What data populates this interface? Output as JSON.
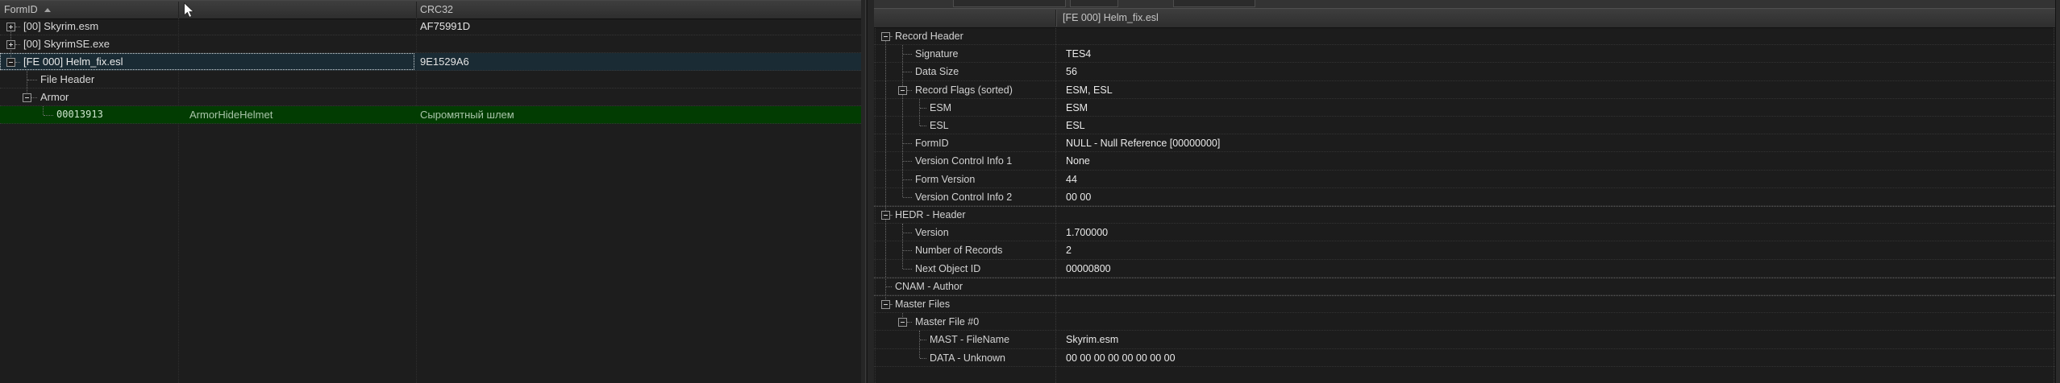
{
  "left_panel": {
    "header": {
      "formid_label": "FormID",
      "sort_direction": "ascending",
      "editorid_label": "",
      "crc_label": "CRC32"
    },
    "rows": [
      {
        "text": "[00] Skyrim.esm",
        "level": 0,
        "expander": "plus",
        "col2": "",
        "col3": "AF75991D",
        "state": "normal"
      },
      {
        "text": "[00] SkyrimSE.exe",
        "level": 0,
        "expander": "plus",
        "col2": "",
        "col3": "",
        "state": "normal"
      },
      {
        "text": "[FE 000] Helm_fix.esl",
        "level": 0,
        "expander": "minus",
        "col2": "",
        "col3": "9E1529A6",
        "state": "selected"
      },
      {
        "text": "File Header",
        "level": 1,
        "expander": "none",
        "col2": "",
        "col3": "",
        "state": "normal"
      },
      {
        "text": "Armor",
        "level": 1,
        "expander": "minus",
        "col2": "",
        "col3": "",
        "state": "normal"
      },
      {
        "text": "00013913",
        "level": 2,
        "expander": "none",
        "col2": "ArmorHideHelmet",
        "col3": "Сыромятный шлем",
        "state": "green"
      }
    ]
  },
  "right_panel": {
    "title": "[FE 000] Helm_fix.esl",
    "rows": [
      {
        "label": "Record Header",
        "level": 0,
        "expander": "minus",
        "value": ""
      },
      {
        "label": "Signature",
        "level": 1,
        "expander": "none",
        "value": "TES4"
      },
      {
        "label": "Data Size",
        "level": 1,
        "expander": "none",
        "value": "56"
      },
      {
        "label": "Record Flags (sorted)",
        "level": 1,
        "expander": "minus",
        "value": "ESM, ESL"
      },
      {
        "label": "ESM",
        "level": 2,
        "expander": "none",
        "value": "ESM"
      },
      {
        "label": "ESL",
        "level": 2,
        "expander": "none",
        "value": "ESL"
      },
      {
        "label": "FormID",
        "level": 1,
        "expander": "none",
        "value": "NULL - Null Reference [00000000]"
      },
      {
        "label": "Version Control Info 1",
        "level": 1,
        "expander": "none",
        "value": "None"
      },
      {
        "label": "Form Version",
        "level": 1,
        "expander": "none",
        "value": "44"
      },
      {
        "label": "Version Control Info 2",
        "level": 1,
        "expander": "none",
        "value": "00 00"
      },
      {
        "label": "HEDR - Header",
        "level": 0,
        "expander": "minus",
        "value": ""
      },
      {
        "label": "Version",
        "level": 1,
        "expander": "none",
        "value": "1.700000"
      },
      {
        "label": "Number of Records",
        "level": 1,
        "expander": "none",
        "value": "2"
      },
      {
        "label": "Next Object ID",
        "level": 1,
        "expander": "none",
        "value": "00000800"
      },
      {
        "label": "CNAM - Author",
        "level": 0,
        "expander": "none",
        "value": ""
      },
      {
        "label": "Master Files",
        "level": 0,
        "expander": "minus",
        "value": ""
      },
      {
        "label": "Master File #0",
        "level": 1,
        "expander": "minus",
        "value": ""
      },
      {
        "label": "MAST - FileName",
        "level": 2,
        "expander": "none",
        "value": "Skyrim.esm"
      },
      {
        "label": "DATA - Unknown",
        "level": 2,
        "expander": "none",
        "value": "00 00 00 00 00 00 00 00"
      }
    ]
  },
  "colors": {
    "selected_row_bg": "#1a2b34",
    "green_record_bg": "#023c02",
    "green_record_text": "#a9c4a9",
    "panel_bg": "#1d1d1d",
    "header_text": "#c6c6c6",
    "row_text": "#d8d8d8",
    "value_text": "#e9e9e9"
  }
}
